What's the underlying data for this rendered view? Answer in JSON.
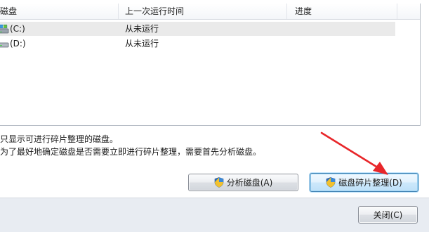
{
  "columns": {
    "disk": "磁盘",
    "last_run": "上一次运行时间",
    "progress": "进度"
  },
  "rows": [
    {
      "drive": "(C:)",
      "last_run": "从未运行",
      "progress": "",
      "icon": "system-drive-icon"
    },
    {
      "drive": "(D:)",
      "last_run": "从未运行",
      "progress": "",
      "icon": "drive-icon"
    }
  ],
  "hints": {
    "line1": "只显示可进行碎片整理的磁盘。",
    "line2": "为了最好地确定磁盘是否需要立即进行碎片整理，需要首先分析磁盘。"
  },
  "buttons": {
    "analyze": "分析磁盘(A)",
    "defragment": "磁盘碎片整理(D)",
    "close": "关闭(C)"
  },
  "colors": {
    "annotation_arrow": "#e8262a",
    "focus_border": "#3c7fb1"
  }
}
